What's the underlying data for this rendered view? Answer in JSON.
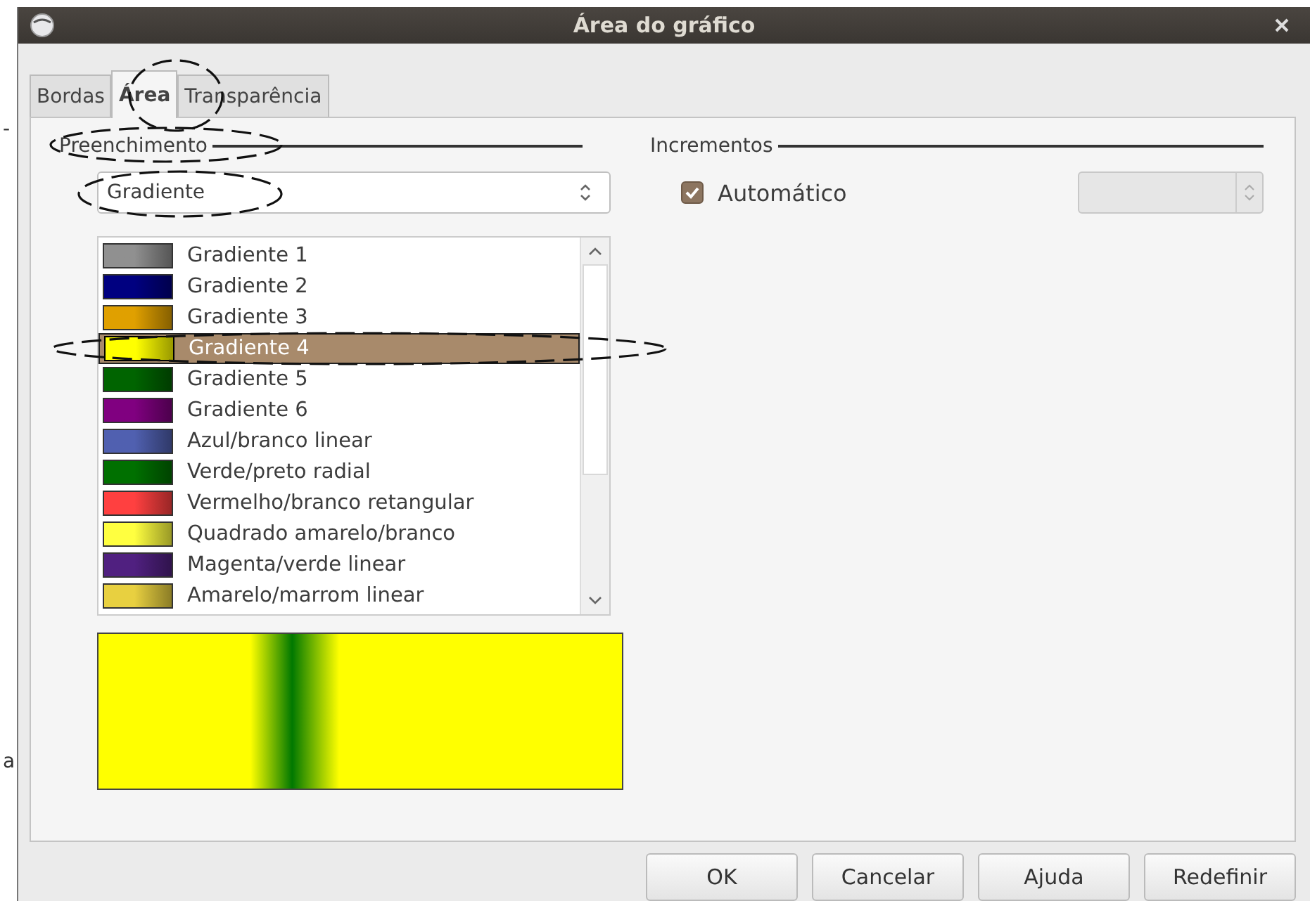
{
  "window": {
    "title": "Área do gráfico"
  },
  "stray_marks": [
    "-",
    "a"
  ],
  "tabs": [
    {
      "label": "Bordas",
      "selected": false
    },
    {
      "label": "Área",
      "selected": true
    },
    {
      "label": "Transparência",
      "selected": false
    }
  ],
  "fill": {
    "legend": "Preenchimento",
    "type_select": {
      "value": "Gradiente"
    },
    "gradients": [
      {
        "label": "Gradiente 1",
        "selected": false,
        "color": "#909090"
      },
      {
        "label": "Gradiente 2",
        "selected": false,
        "color": "#000080"
      },
      {
        "label": "Gradiente 3",
        "selected": false,
        "color": "#e0a000"
      },
      {
        "label": "Gradiente 4",
        "selected": true,
        "color": "#ffff00"
      },
      {
        "label": "Gradiente 5",
        "selected": false,
        "color": "#006400"
      },
      {
        "label": "Gradiente 6",
        "selected": false,
        "color": "#800080"
      },
      {
        "label": "Azul/branco linear",
        "selected": false,
        "color": "#5060b0"
      },
      {
        "label": "Verde/preto radial",
        "selected": false,
        "color": "#007000"
      },
      {
        "label": "Vermelho/branco retangular",
        "selected": false,
        "color": "#ff4040"
      },
      {
        "label": "Quadrado amarelo/branco",
        "selected": false,
        "color": "#ffff40"
      },
      {
        "label": "Magenta/verde linear",
        "selected": false,
        "color": "#502080"
      },
      {
        "label": "Amarelo/marrom linear",
        "selected": false,
        "color": "#e8d040"
      }
    ]
  },
  "increments": {
    "legend": "Incrementos",
    "automatic": {
      "label": "Automático",
      "checked": true
    },
    "step_field": {
      "disabled": true
    }
  },
  "buttons": [
    "OK",
    "Cancelar",
    "Ajuda",
    "Redefinir"
  ]
}
